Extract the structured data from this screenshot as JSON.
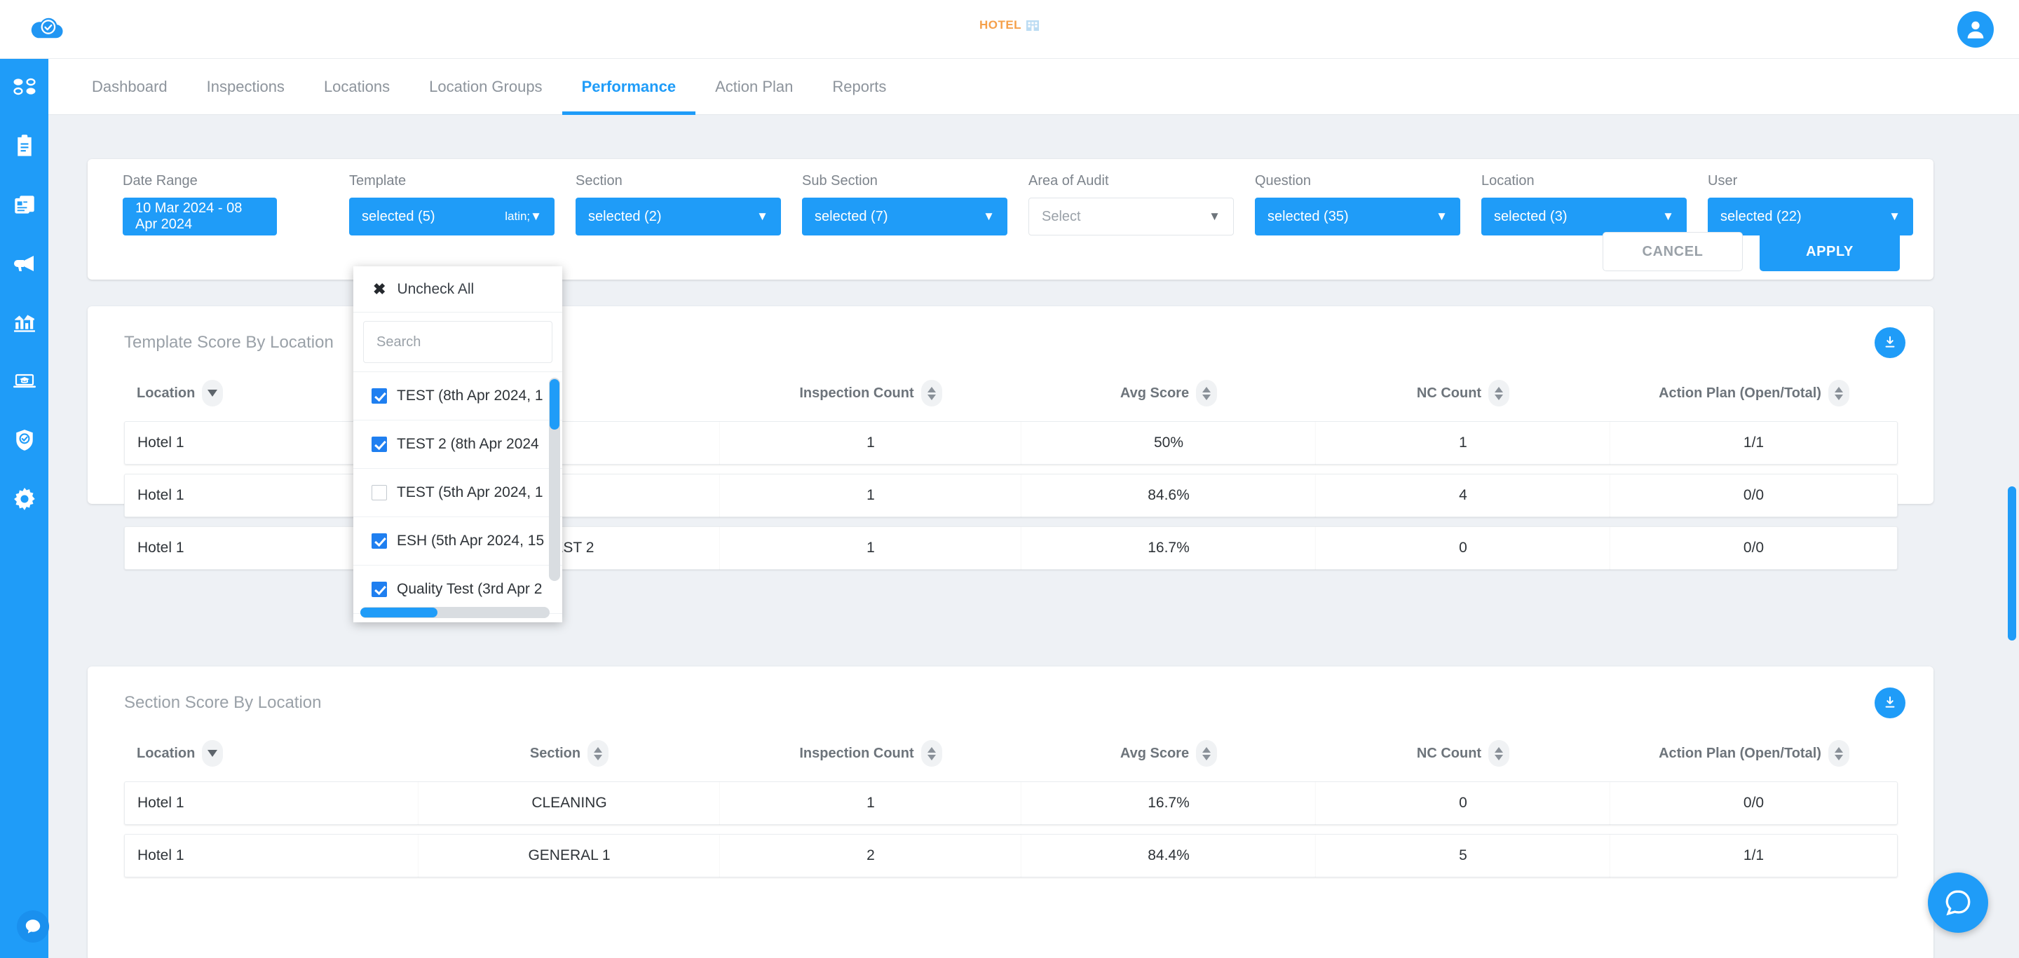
{
  "header": {
    "brand_icon": "cloud-check-icon",
    "center_logo_text": "HOTEL",
    "center_logo_icon": "building-icon",
    "avatar_icon": "user-avatar-icon"
  },
  "sidebar": {
    "items": [
      {
        "icon": "dots-grid-icon",
        "name": "sidebar-item-dashboard"
      },
      {
        "icon": "clipboard-icon",
        "name": "sidebar-item-inspections"
      },
      {
        "icon": "documents-icon",
        "name": "sidebar-item-documents"
      },
      {
        "icon": "megaphone-icon",
        "name": "sidebar-item-announcements"
      },
      {
        "icon": "bar-chart-icon",
        "name": "sidebar-item-analytics"
      },
      {
        "icon": "graduation-laptop-icon",
        "name": "sidebar-item-training"
      },
      {
        "icon": "shield-check-icon",
        "name": "sidebar-item-compliance"
      },
      {
        "icon": "gear-icon",
        "name": "sidebar-item-settings"
      }
    ],
    "chat_icon": "chat-bubble-icon"
  },
  "nav": {
    "tabs": [
      {
        "label": "Dashboard",
        "active": false
      },
      {
        "label": "Inspections",
        "active": false
      },
      {
        "label": "Locations",
        "active": false
      },
      {
        "label": "Location Groups",
        "active": false
      },
      {
        "label": "Performance",
        "active": true
      },
      {
        "label": "Action Plan",
        "active": false
      },
      {
        "label": "Reports",
        "active": false
      }
    ]
  },
  "filters": {
    "date_range": {
      "label": "Date Range",
      "value": "10 Mar 2024 - 08 Apr 2024"
    },
    "template": {
      "label": "Template",
      "value": "selected (5)"
    },
    "section": {
      "label": "Section",
      "value": "selected (2)"
    },
    "sub_section": {
      "label": "Sub Section",
      "value": "selected (7)"
    },
    "area_of_audit": {
      "label": "Area of Audit",
      "value": "Select"
    },
    "question": {
      "label": "Question",
      "value": "selected (35)"
    },
    "location": {
      "label": "Location",
      "value": "selected (3)"
    },
    "user": {
      "label": "User",
      "value": "selected (22)"
    },
    "cancel_label": "CANCEL",
    "apply_label": "APPLY"
  },
  "template_dropdown": {
    "uncheck_all_label": "Uncheck All",
    "search_placeholder": "Search",
    "options": [
      {
        "label": "TEST (8th Apr 2024, 1",
        "checked": true
      },
      {
        "label": "TEST 2 (8th Apr 2024",
        "checked": true
      },
      {
        "label": "TEST (5th Apr 2024, 1",
        "checked": false
      },
      {
        "label": "ESH (5th Apr 2024, 15",
        "checked": true
      },
      {
        "label": "Quality Test (3rd Apr 2",
        "checked": true
      }
    ]
  },
  "template_score_card": {
    "title": "Template Score By Location",
    "download_icon": "download-icon",
    "columns": [
      {
        "label": "Location",
        "sort": "desc"
      },
      {
        "label": "",
        "sort": "none"
      },
      {
        "label": "Inspection Count",
        "sort": "both"
      },
      {
        "label": "Avg Score",
        "sort": "both"
      },
      {
        "label": "NC Count",
        "sort": "both"
      },
      {
        "label": "Action Plan (Open/Total)",
        "sort": "both"
      }
    ],
    "rows": [
      {
        "location": "Hotel 1",
        "template": "",
        "inspection_count": "1",
        "avg_score": "50%",
        "nc_count": "1",
        "action_plan": "1/1"
      },
      {
        "location": "Hotel 1",
        "template": "",
        "inspection_count": "1",
        "avg_score": "84.6%",
        "nc_count": "4",
        "action_plan": "0/0"
      },
      {
        "location": "Hotel 1",
        "template": "TEST 2",
        "inspection_count": "1",
        "avg_score": "16.7%",
        "nc_count": "0",
        "action_plan": "0/0"
      }
    ]
  },
  "section_score_card": {
    "title": "Section Score By Location",
    "download_icon": "download-icon",
    "columns": [
      {
        "label": "Location",
        "sort": "desc"
      },
      {
        "label": "Section",
        "sort": "both"
      },
      {
        "label": "Inspection Count",
        "sort": "both"
      },
      {
        "label": "Avg Score",
        "sort": "both"
      },
      {
        "label": "NC Count",
        "sort": "both"
      },
      {
        "label": "Action Plan (Open/Total)",
        "sort": "both"
      }
    ],
    "rows": [
      {
        "location": "Hotel 1",
        "section": "CLEANING",
        "inspection_count": "1",
        "avg_score": "16.7%",
        "nc_count": "0",
        "action_plan": "0/0"
      },
      {
        "location": "Hotel 1",
        "section": "GENERAL 1",
        "inspection_count": "2",
        "avg_score": "84.4%",
        "nc_count": "5",
        "action_plan": "1/1"
      }
    ]
  },
  "colors": {
    "accent": "#1f9cf8",
    "checkbox": "#1f7ff0",
    "logo_orange": "#f5a04a",
    "page_bg": "#eef1f5"
  },
  "chat_widget_icon": "chat-bubble-icon"
}
